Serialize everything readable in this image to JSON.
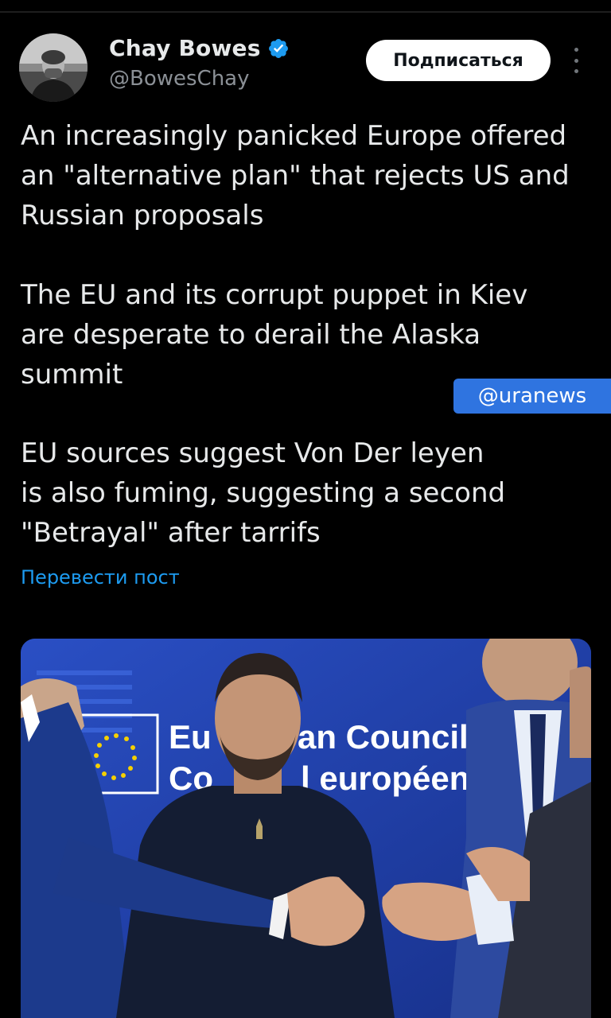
{
  "author": {
    "name": "Chay Bowes",
    "handle": "@BowesChay",
    "verified": true,
    "verified_color": "#1d9bf0"
  },
  "actions": {
    "subscribe_label": "Подписаться",
    "more_icon": "more-vertical-icon"
  },
  "tweet": {
    "paragraphs": [
      "An increasingly panicked Europe offered\nan \"alternative plan\" that rejects US and\nRussian proposals",
      "The EU and its corrupt puppet in Kiev\nare desperate to derail the Alaska\nsummit",
      "EU sources suggest Von Der leyen\nis also fuming, suggesting a second\n\"Betrayal\" after tarrifs"
    ],
    "translate_label": "Перевести пост"
  },
  "watermark": "@uranews",
  "photo": {
    "sign_line1": "Eu",
    "sign_line1b": "an Council",
    "sign_line2": "Co",
    "sign_line2b": "l européen"
  },
  "colors": {
    "background": "#000000",
    "text": "#e7e9ea",
    "secondary": "#8b9096",
    "link": "#1d9bf0",
    "watermark_bg": "#2f74e0"
  }
}
